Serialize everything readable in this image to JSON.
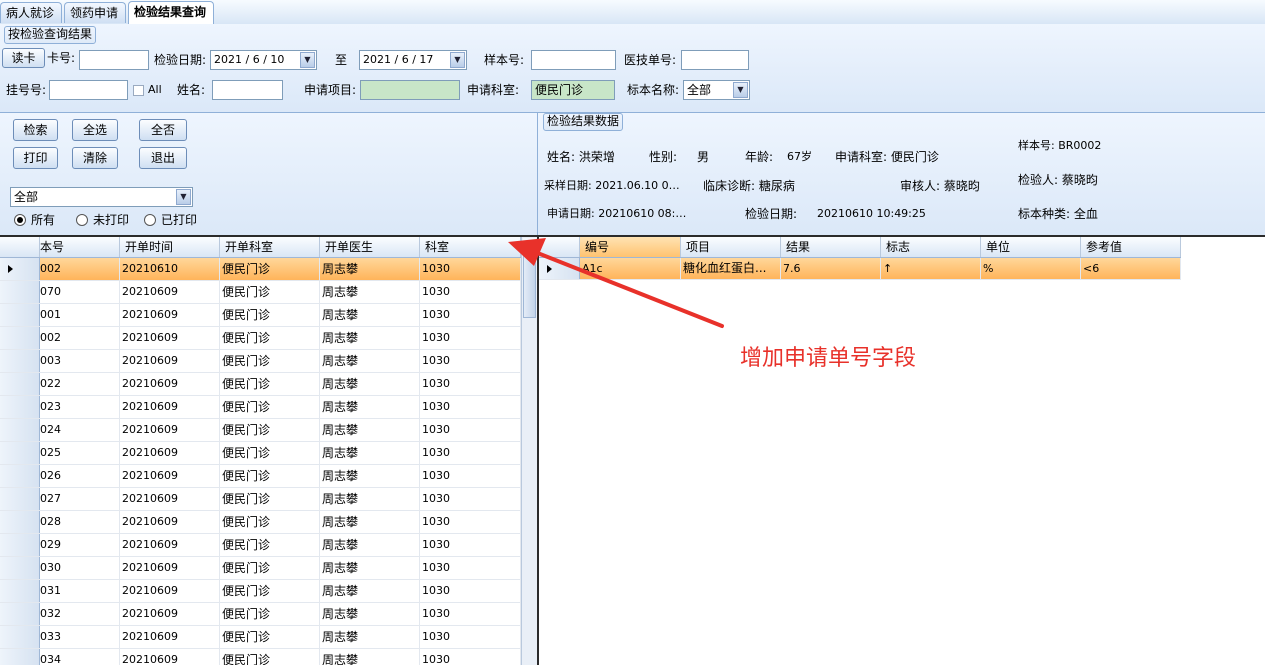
{
  "tabs": [
    {
      "label": "病人就诊"
    },
    {
      "label": "领药申请"
    },
    {
      "label": "检验结果查询"
    }
  ],
  "query": {
    "group_title": "按检验查询结果",
    "read_card_label": "读卡",
    "card_no_label": "卡号:",
    "card_no_value": "",
    "test_date_label": "检验日期:",
    "date_from": "2021 / 6 / 10",
    "date_to_label": "至",
    "date_to": "2021 / 6 / 17",
    "sample_no_label": "样本号:",
    "sample_no_value": "",
    "tech_no_label": "医技单号:",
    "tech_no_value": "",
    "reg_no_label": "挂号号:",
    "reg_no_value": "",
    "all_label": "All",
    "name_label": "姓名:",
    "name_value": "",
    "apply_item_label": "申请项目:",
    "apply_item_value": "",
    "apply_dept_label": "申请科室:",
    "apply_dept_value": "便民门诊",
    "specimen_name_label": "标本名称:",
    "specimen_name_value": "全部"
  },
  "left_controls": {
    "search_label": "检索",
    "select_all_label": "全选",
    "select_none_label": "全否",
    "print_label": "打印",
    "clear_label": "清除",
    "exit_label": "退出",
    "filter_value": "全部",
    "radio_all": "所有",
    "radio_unprinted": "未打印",
    "radio_printed": "已打印"
  },
  "result_info": {
    "group_title": "检验结果数据",
    "name": "姓名: 洪荣增",
    "sex_label": "性别:",
    "sex_value": "男",
    "age_label": "年龄:",
    "age_value": "67岁",
    "dept": "申请科室: 便民门诊",
    "sample_no": "样本号: BR0002",
    "collect_date": "采样日期: 2021.06.10 0…",
    "diagnosis": "临床诊断: 糖尿病",
    "reviewer": "审核人: 蔡晓昀",
    "inspector": "检验人: 蔡晓昀",
    "apply_date": "申请日期: 20210610 08:…",
    "test_date_label": "检验日期:",
    "test_date_value": "20210610 10:49:25",
    "specimen_type": "标本种类: 全血"
  },
  "left_table": {
    "columns": [
      "本号",
      "开单时间",
      "开单科室",
      "开单医生",
      "科室"
    ],
    "rows": [
      [
        "002",
        "20210610",
        "便民门诊",
        "周志攀",
        "1030"
      ],
      [
        "070",
        "20210609",
        "便民门诊",
        "周志攀",
        "1030"
      ],
      [
        "001",
        "20210609",
        "便民门诊",
        "周志攀",
        "1030"
      ],
      [
        "002",
        "20210609",
        "便民门诊",
        "周志攀",
        "1030"
      ],
      [
        "003",
        "20210609",
        "便民门诊",
        "周志攀",
        "1030"
      ],
      [
        "022",
        "20210609",
        "便民门诊",
        "周志攀",
        "1030"
      ],
      [
        "023",
        "20210609",
        "便民门诊",
        "周志攀",
        "1030"
      ],
      [
        "024",
        "20210609",
        "便民门诊",
        "周志攀",
        "1030"
      ],
      [
        "025",
        "20210609",
        "便民门诊",
        "周志攀",
        "1030"
      ],
      [
        "026",
        "20210609",
        "便民门诊",
        "周志攀",
        "1030"
      ],
      [
        "027",
        "20210609",
        "便民门诊",
        "周志攀",
        "1030"
      ],
      [
        "028",
        "20210609",
        "便民门诊",
        "周志攀",
        "1030"
      ],
      [
        "029",
        "20210609",
        "便民门诊",
        "周志攀",
        "1030"
      ],
      [
        "030",
        "20210609",
        "便民门诊",
        "周志攀",
        "1030"
      ],
      [
        "031",
        "20210609",
        "便民门诊",
        "周志攀",
        "1030"
      ],
      [
        "032",
        "20210609",
        "便民门诊",
        "周志攀",
        "1030"
      ],
      [
        "033",
        "20210609",
        "便民门诊",
        "周志攀",
        "1030"
      ],
      [
        "034",
        "20210609",
        "便民门诊",
        "周志攀",
        "1030"
      ]
    ]
  },
  "right_table": {
    "columns": [
      "编号",
      "项目",
      "结果",
      "标志",
      "单位",
      "参考值"
    ],
    "rows": [
      [
        "A1c",
        "糖化血红蛋白...",
        "7.6",
        "↑",
        "%",
        "<6"
      ]
    ]
  },
  "annotation": {
    "text": "增加申请单号字段",
    "color": "#e8312a"
  },
  "colors": {
    "selected_row": "#ffb45a",
    "panel_bg": "#dbe8f8",
    "accent_border": "#8fb0d8"
  }
}
